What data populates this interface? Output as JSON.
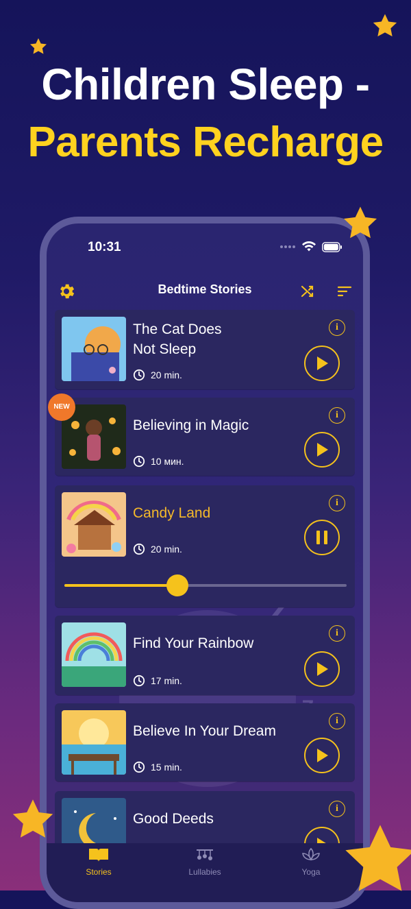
{
  "headline": {
    "line1": "Children Sleep -",
    "line2": "Parents Recharge"
  },
  "status": {
    "time": "10:31"
  },
  "nav": {
    "title": "Bedtime Stories",
    "settings_icon": "gear-icon",
    "shuffle_icon": "shuffle-icon",
    "sort_icon": "sort-icon"
  },
  "stories": [
    {
      "title_line1": "The Cat Does",
      "title_line2": "Not Sleep",
      "duration": "20 min.",
      "state": "play"
    },
    {
      "title_line1": "Believing in Magic",
      "title_line2": "",
      "duration": "10 мин.",
      "state": "play",
      "badge": "NEW"
    },
    {
      "title_line1": "Candy Land",
      "title_line2": "",
      "duration": "20 min.",
      "state": "pause",
      "progress_fraction": 0.4
    },
    {
      "title_line1": "Find Your Rainbow",
      "title_line2": "",
      "duration": "17 min.",
      "state": "play"
    },
    {
      "title_line1": "Believe In Your Dream",
      "title_line2": "",
      "duration": "15 min.",
      "state": "play"
    },
    {
      "title_line1": "Good Deeds",
      "title_line2": "",
      "duration": "",
      "state": "play"
    }
  ],
  "info_glyph": "i",
  "tabs": [
    {
      "label": "Stories",
      "active": true
    },
    {
      "label": "Lullabies",
      "active": false
    },
    {
      "label": "Yoga",
      "active": false
    }
  ],
  "decor": {
    "sleep_letters": "Z"
  },
  "colors": {
    "accent": "#f5c21c",
    "active_title": "#f5b92a",
    "headline_yellow": "#ffd21f",
    "badge": "#f0782a"
  }
}
